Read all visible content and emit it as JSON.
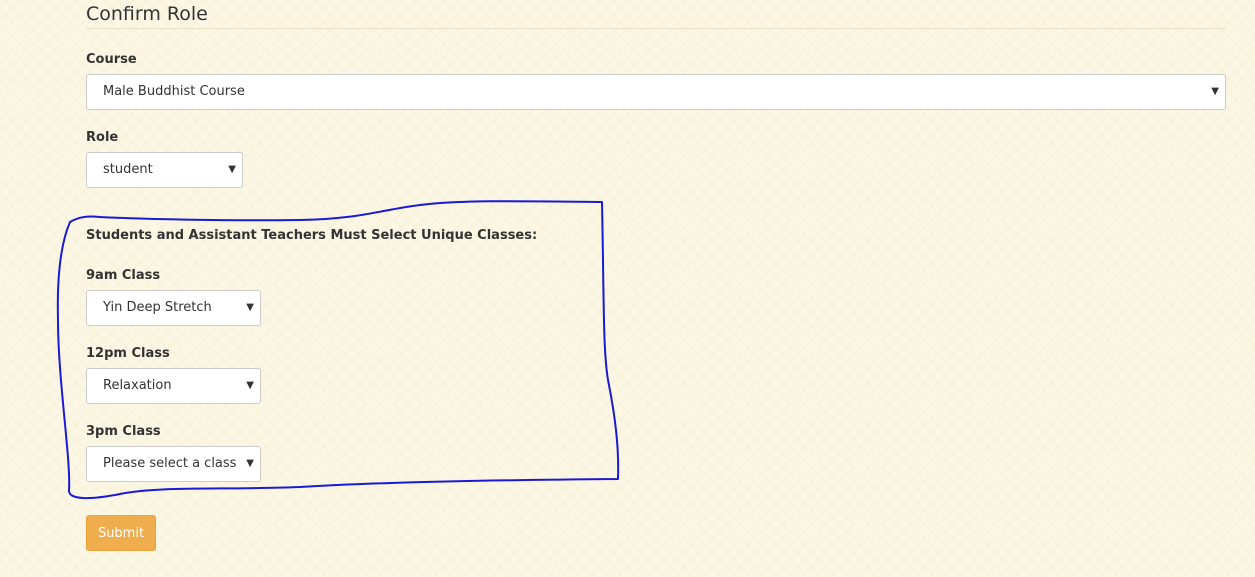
{
  "page": {
    "title": "Confirm Role"
  },
  "form": {
    "course": {
      "label": "Course",
      "selected": "Male Buddhist Course"
    },
    "role": {
      "label": "Role",
      "selected": "student"
    },
    "classes_heading": "Students and Assistant Teachers Must Select Unique Classes:",
    "class_9am": {
      "label": "9am Class",
      "selected": "Yin Deep Stretch"
    },
    "class_12pm": {
      "label": "12pm Class",
      "selected": "Relaxation"
    },
    "class_3pm": {
      "label": "3pm Class",
      "selected": "Please select a class"
    },
    "submit_label": "Submit",
    "caret_glyph": "▼"
  },
  "colors": {
    "background": "#fbf7e4",
    "submit_button": "#f0ad4e",
    "annotation_stroke": "#1a1ad6"
  },
  "icons": {
    "dropdown": "caret-down-icon"
  }
}
